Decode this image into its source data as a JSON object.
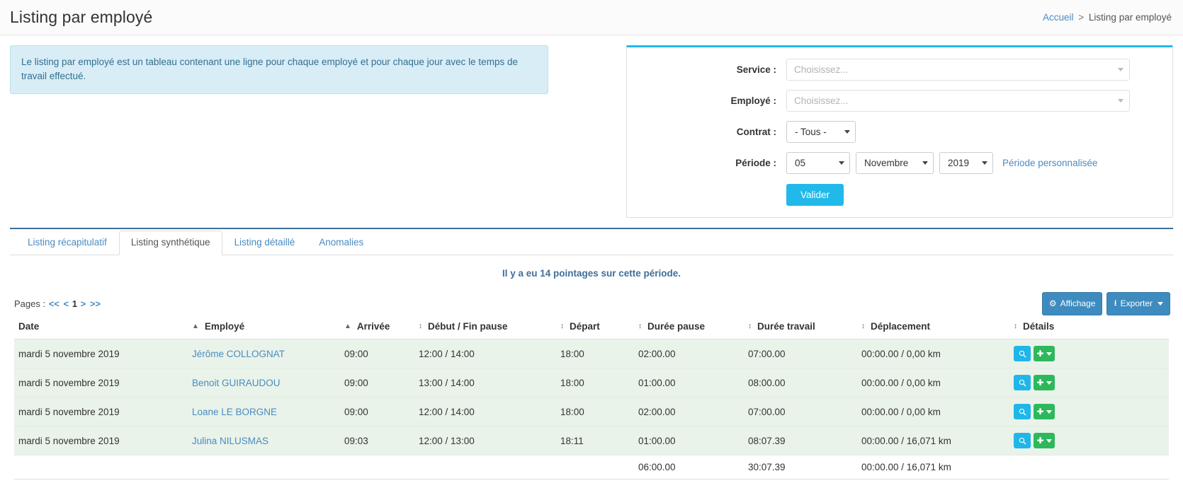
{
  "header": {
    "title": "Listing par employé",
    "breadcrumb": {
      "home": "Accueil",
      "separator": ">",
      "current": "Listing par employé"
    }
  },
  "alert": {
    "text": "Le listing par employé est un tableau contenant une ligne pour chaque employé et pour chaque jour avec le temps de travail effectué."
  },
  "filters": {
    "service": {
      "label": "Service :",
      "placeholder": "Choisissez...",
      "value": ""
    },
    "employe": {
      "label": "Employé :",
      "placeholder": "Choisissez...",
      "value": ""
    },
    "contrat": {
      "label": "Contrat :",
      "value": "- Tous -"
    },
    "periode": {
      "label": "Période :",
      "day": "05",
      "month": "Novembre",
      "year": "2019",
      "custom_link": "Période personnalisée"
    },
    "submit_label": "Valider"
  },
  "tabs": [
    {
      "label": "Listing récapitulatif",
      "active": false
    },
    {
      "label": "Listing synthétique",
      "active": true
    },
    {
      "label": "Listing détaillé",
      "active": false
    },
    {
      "label": "Anomalies",
      "active": false
    }
  ],
  "count_message": "Il y a eu 14 pointages sur cette période.",
  "pagination": {
    "label": "Pages :",
    "first": "<<",
    "prev": "<",
    "current": "1",
    "next": ">",
    "last": ">>"
  },
  "toolbar": {
    "display_label": "Affichage",
    "export_label": "Exporter"
  },
  "table": {
    "columns": [
      {
        "label": "Date",
        "sort": "asc"
      },
      {
        "label": "Employé",
        "sort": "asc"
      },
      {
        "label": "Arrivée",
        "sort": "both"
      },
      {
        "label": "Début / Fin pause",
        "sort": "both"
      },
      {
        "label": "Départ",
        "sort": "both"
      },
      {
        "label": "Durée pause",
        "sort": "both"
      },
      {
        "label": "Durée travail",
        "sort": "both"
      },
      {
        "label": "Déplacement",
        "sort": "both"
      },
      {
        "label": "Détails",
        "sort": "none"
      }
    ],
    "rows": [
      {
        "date": "mardi 5 novembre 2019",
        "employe": "Jérôme COLLOGNAT",
        "arrivee": "09:00",
        "pause": "12:00 / 14:00",
        "depart": "18:00",
        "duree_pause": "02:00.00",
        "duree_travail": "07:00.00",
        "deplacement": "00:00.00 / 0,00 km"
      },
      {
        "date": "mardi 5 novembre 2019",
        "employe": "Benoit GUIRAUDOU",
        "arrivee": "09:00",
        "pause": "13:00 / 14:00",
        "depart": "18:00",
        "duree_pause": "01:00.00",
        "duree_travail": "08:00.00",
        "deplacement": "00:00.00 / 0,00 km"
      },
      {
        "date": "mardi 5 novembre 2019",
        "employe": "Loane LE BORGNE",
        "arrivee": "09:00",
        "pause": "12:00 / 14:00",
        "depart": "18:00",
        "duree_pause": "02:00.00",
        "duree_travail": "07:00.00",
        "deplacement": "00:00.00 / 0,00 km"
      },
      {
        "date": "mardi 5 novembre 2019",
        "employe": "Julina NILUSMAS",
        "arrivee": "09:03",
        "pause": "12:00 / 13:00",
        "depart": "18:11",
        "duree_pause": "01:00.00",
        "duree_travail": "08:07.39",
        "deplacement": "00:00.00 / 16,071 km"
      }
    ],
    "totals": {
      "duree_pause": "06:00.00",
      "duree_travail": "30:07.39",
      "deplacement": "00:00.00 / 16,071 km"
    }
  },
  "colors": {
    "accent_cyan": "#21b9ea",
    "link_blue": "#4a8bc2",
    "row_green": "#e9f3e9",
    "alert_bg": "#d9edf7",
    "btn_blue": "#3e8bbf",
    "btn_green": "#2eb85c"
  }
}
